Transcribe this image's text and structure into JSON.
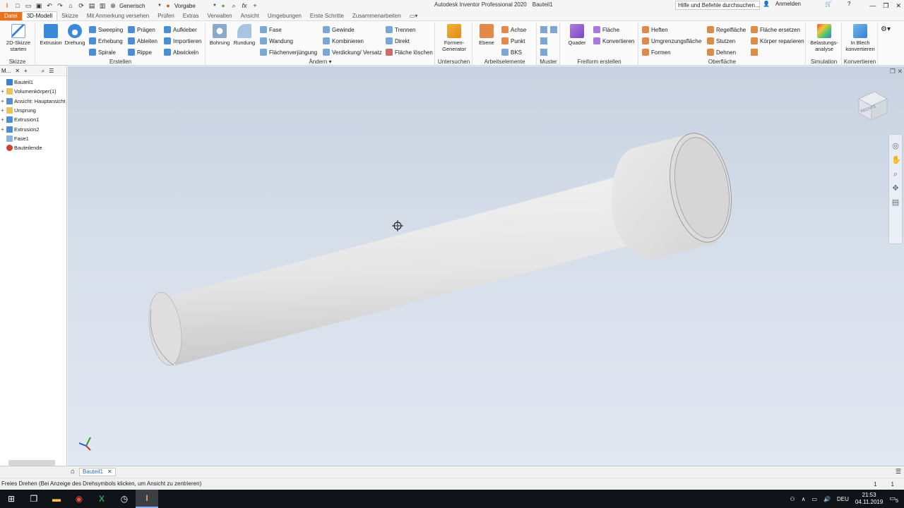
{
  "titlebar": {
    "quick_access": [
      "app-menu-icon",
      "new-icon",
      "open-icon",
      "save-icon",
      "undo-icon",
      "redo-icon",
      "home-icon",
      "update-icon",
      "select-icon",
      "print-icon",
      "material-clear-icon"
    ],
    "material_dropdown": "Generisch",
    "appearance_dropdown": "Vorgabe",
    "app_name": "Autodesk Inventor Professional 2020",
    "doc_name": "Bauteil1",
    "search_placeholder": "Hilfe und Befehle durchsuchen...",
    "signin": "Anmelden"
  },
  "tabs": [
    "Datei",
    "3D-Modell",
    "Skizze",
    "Mit Anmerkung versehen",
    "Prüfen",
    "Extras",
    "Verwalten",
    "Ansicht",
    "Umgebungen",
    "Erste Schritte",
    "Zusammenarbeiten"
  ],
  "active_tab": "3D-Modell",
  "ribbon": {
    "skizze": {
      "label": "Skizze",
      "button": "2D-Skizze starten"
    },
    "erstellen": {
      "label": "Erstellen",
      "big": [
        "Extrusion",
        "Drehung"
      ],
      "col1": [
        "Sweeping",
        "Erhebung",
        "Spirale"
      ],
      "col2": [
        "Prägen",
        "Ableiten",
        "Rippe"
      ],
      "col3": [
        "Aufkleber",
        "Importieren",
        "Abwickeln"
      ]
    },
    "aendern": {
      "label": "Ändern",
      "big": [
        "Bohrung",
        "Rundung"
      ],
      "col1": [
        "Fase",
        "Wandung",
        "Flächenverjüngung"
      ],
      "col2": [
        "Gewinde",
        "Kombinieren",
        "Verdickung/ Versatz"
      ],
      "col3": [
        "Trennen",
        "Direkt",
        "Fläche löschen"
      ]
    },
    "untersuchen": {
      "label": "Untersuchen",
      "button": "Formen-Generator"
    },
    "arbeitselemente": {
      "label": "Arbeitselemente",
      "big": "Ebene",
      "small": [
        "Achse",
        "Punkt",
        "BKS"
      ]
    },
    "muster": {
      "label": "Muster"
    },
    "freiform": {
      "label": "Freiform erstellen",
      "big": "Quader",
      "small": [
        "Fläche",
        "Konvertieren"
      ]
    },
    "oberflaeche": {
      "label": "Oberfläche",
      "col1": [
        "Heften",
        "Umgrenzungsfläche",
        "Formen"
      ],
      "col2": [
        "Regelfläche",
        "Stutzen",
        "Dehnen"
      ],
      "col3": [
        "Fläche ersetzen",
        "Körper reparieren"
      ]
    },
    "simulation": {
      "label": "Simulation",
      "button": "Belastungs-analyse"
    },
    "konvertieren": {
      "label": "Konvertieren",
      "button": "In Blech konvertieren"
    }
  },
  "browser": {
    "title": "M...",
    "items": [
      {
        "label": "Bauteil1",
        "expand": "",
        "icon": "part-icon",
        "color": "#3b7fd1"
      },
      {
        "label": "Volumenkörper(1)",
        "expand": "+",
        "icon": "folder-icon",
        "color": "#e8c25a"
      },
      {
        "label": "Ansicht: Hauptansicht",
        "expand": "+",
        "icon": "view-icon",
        "color": "#5a8fcf"
      },
      {
        "label": "Ursprung",
        "expand": "+",
        "icon": "folder-icon",
        "color": "#e8c25a"
      },
      {
        "label": "Extrusion1",
        "expand": "+",
        "icon": "extrusion-icon",
        "color": "#4a8ed6"
      },
      {
        "label": "Extrusion2",
        "expand": "+",
        "icon": "extrusion-icon",
        "color": "#4a8ed6"
      },
      {
        "label": "Fase1",
        "expand": "",
        "icon": "chamfer-icon",
        "color": "#8fb3d9"
      },
      {
        "label": "Bauteilende",
        "expand": "",
        "icon": "end-of-part-icon",
        "color": "#d43b3b"
      }
    ]
  },
  "viewcube_label": "RECHTS",
  "doc_tab": "Bauteil1",
  "status": {
    "message": "Freies Drehen (Bei Anzeige des Drehsymbols klicken, um Ansicht zu zentrieren)",
    "count_a": "1",
    "count_b": "1"
  },
  "taskbar": {
    "language": "DEU",
    "time": "21:53",
    "date": "04.11.2019",
    "notifications": "5"
  }
}
